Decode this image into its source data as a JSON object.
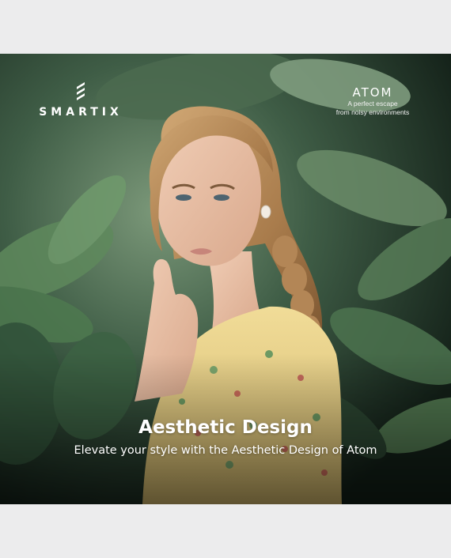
{
  "brand": {
    "name": "SMARTIX",
    "logo_icon": "stacked-slash-mark-icon"
  },
  "product": {
    "name": "ATOM",
    "tagline_line1": "A perfect escape",
    "tagline_line2": "from noisy environments"
  },
  "caption": {
    "headline": "Aesthetic Design",
    "subline": "Elevate your style with the Aesthetic Design of Atom"
  },
  "colors": {
    "page_background": "#ececed",
    "text": "#ffffff",
    "foliage_dark": "#1c2e22",
    "foliage_light": "#6f9a6c",
    "dress_yellow": "#e9d38a",
    "hair": "#b98f5e",
    "skin": "#e8c0a6"
  }
}
